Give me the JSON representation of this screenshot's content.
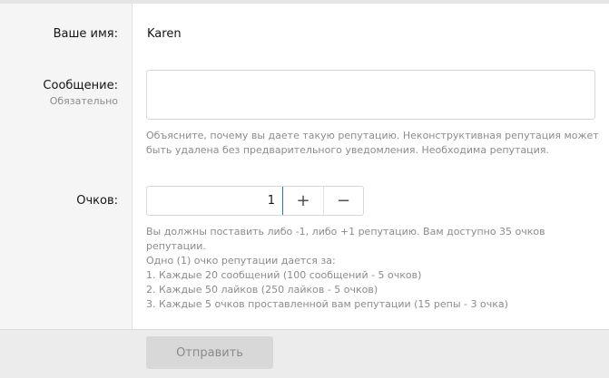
{
  "form": {
    "name_label": "Ваше имя:",
    "name_value": "Karen",
    "message_label": "Сообщение:",
    "message_required": "Обязательно",
    "message_value": "",
    "message_explain_1": "Объясните, почему вы даете такую репутацию. Неконструктивная репутация может",
    "message_explain_2": "быть удалена без предварительного уведомления. Необходима репутация.",
    "points_label": "Очков:",
    "points_value": "1",
    "plus_label": "+",
    "minus_label": "−",
    "points_explain": [
      "Вы должны поставить либо -1, либо +1 репутацию. Вам доступно 35 очков",
      "репутации.",
      "Одно (1) очко репутации дается за:",
      "1. Каждые 20 сообщений (100 сообщений - 5 очков)",
      "2. Каждые 50 лайков (250 лайков - 5 очков)",
      "3. Каждые 5 очков проставленной вам репутации (15 репы - 3 очка)"
    ],
    "submit_label": "Отправить"
  },
  "colors": {
    "label_bg": "#f5f5f5",
    "footer_bg": "#ececec",
    "focus_accent": "#2577b1",
    "button_bg": "#d8d8d8"
  }
}
